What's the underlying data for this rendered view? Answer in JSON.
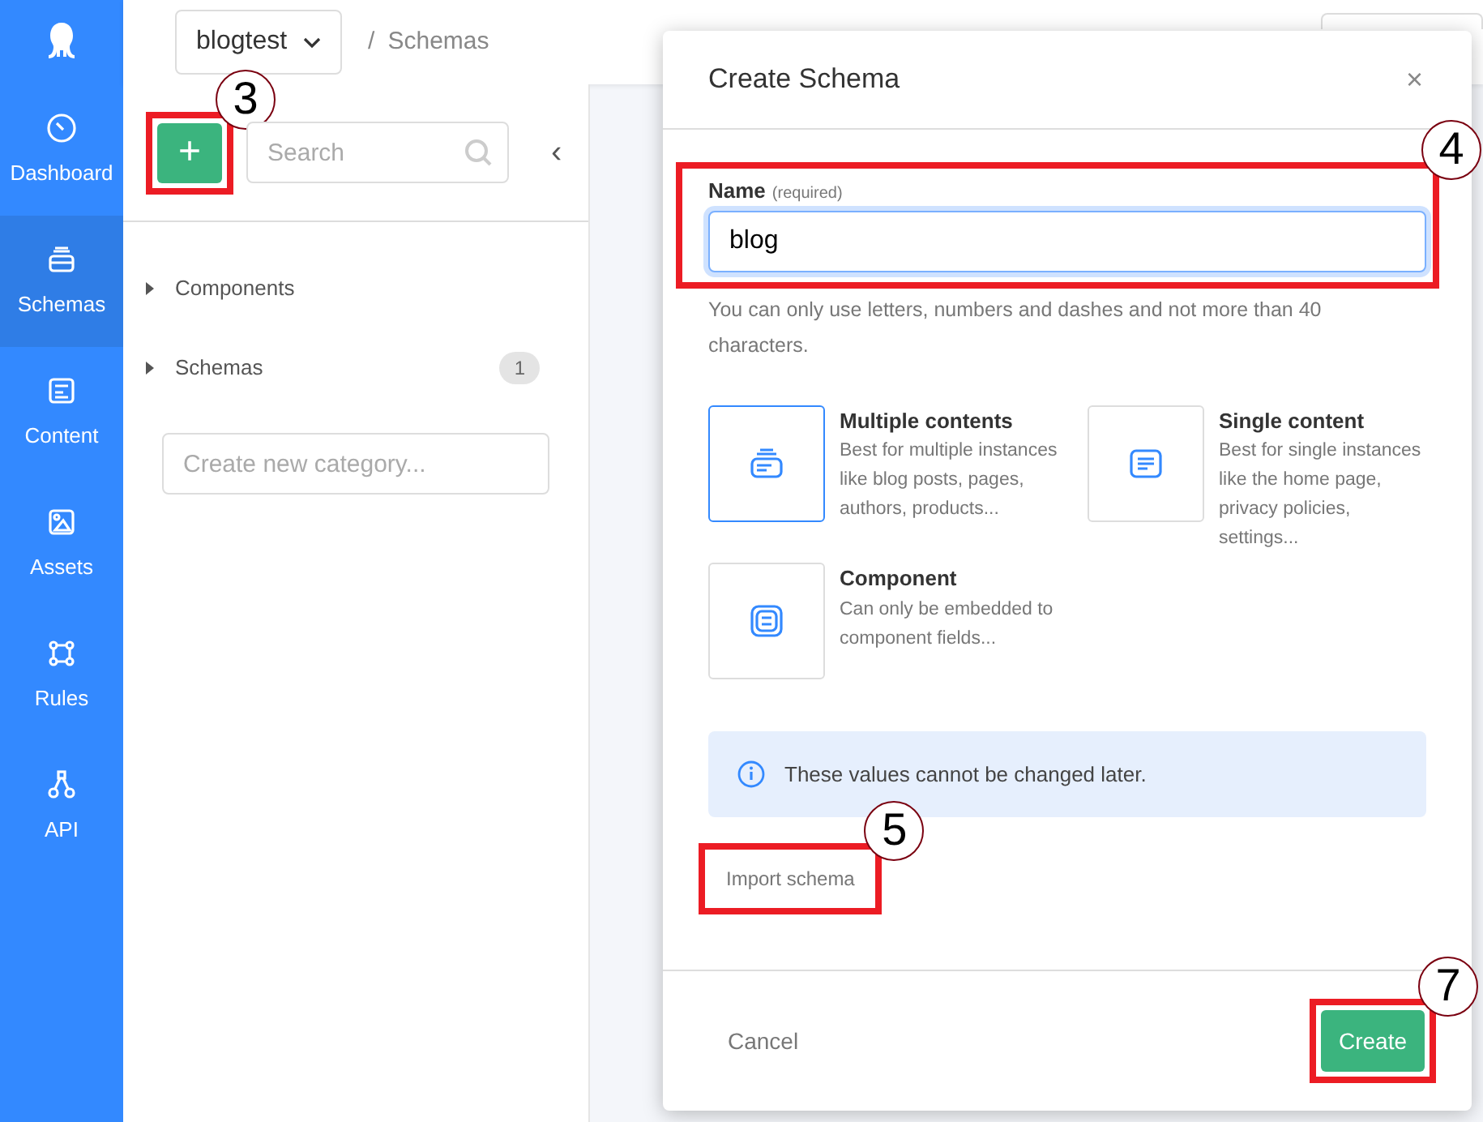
{
  "topbar": {
    "workspace": "blogtest",
    "separator": "/",
    "breadcrumb": "Schemas"
  },
  "nav": [
    {
      "label": "Dashboard",
      "kind": "dashboard",
      "selected": false
    },
    {
      "label": "Schemas",
      "kind": "schemas",
      "selected": true
    },
    {
      "label": "Content",
      "kind": "content",
      "selected": false
    },
    {
      "label": "Assets",
      "kind": "assets",
      "selected": false
    },
    {
      "label": "Rules",
      "kind": "rules",
      "selected": false
    },
    {
      "label": "API",
      "kind": "api",
      "selected": false
    }
  ],
  "panel": {
    "add_symbol": "+",
    "add_callout": "3",
    "search_placeholder": "Search",
    "collapse_symbol": "‹",
    "groups": [
      {
        "label": "Components"
      },
      {
        "label": "Schemas",
        "count": "1"
      }
    ],
    "category_placeholder": "Create new category..."
  },
  "dialog": {
    "title": "Create Schema",
    "close_symbol": "×",
    "name_label": "Name",
    "name_hint": "(required)",
    "name_value": "blog",
    "name_callout": "4",
    "help": "You can only use letters, numbers and dashes and not more than 40 characters.",
    "types": [
      {
        "kind": "multiple",
        "title": "Multiple contents",
        "description": "Best for multiple instances like blog posts, pages, authors, products...",
        "selected": true
      },
      {
        "kind": "single",
        "title": "Single content",
        "description": "Best for single instances like the home page, privacy policies, settings...",
        "selected": false
      },
      {
        "kind": "component",
        "title": "Component",
        "description": "Can only be embedded to component fields...",
        "selected": false
      }
    ],
    "info": "These values cannot be changed later.",
    "import_link": "Import schema",
    "import_callout": "5",
    "cancel": "Cancel",
    "create": "Create",
    "create_callout": "7"
  }
}
